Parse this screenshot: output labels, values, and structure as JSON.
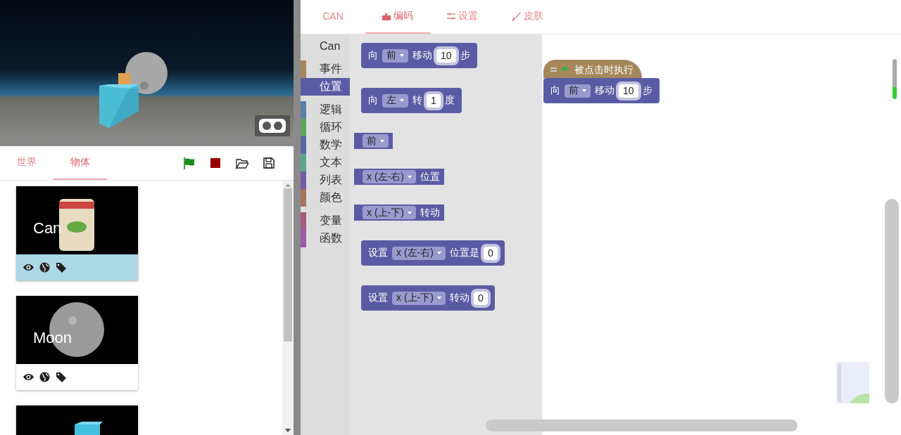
{
  "left_tabs": [
    {
      "label": "世界",
      "selected": false
    },
    {
      "label": "物体",
      "selected": true
    }
  ],
  "objects": [
    {
      "name": "Can",
      "selected": true
    },
    {
      "name": "Moon",
      "selected": false
    }
  ],
  "editor_tabs": [
    {
      "label": "CAN",
      "selected": false
    },
    {
      "label": "编码",
      "selected": true
    },
    {
      "label": "设置",
      "selected": false
    },
    {
      "label": "皮肤",
      "selected": false
    }
  ],
  "toolbox": [
    [
      {
        "label": "Can",
        "selected": false
      }
    ],
    [
      {
        "label": "事件",
        "color": "#a5875a",
        "selected": false
      },
      {
        "label": "位置",
        "color": "#5b5ba5",
        "selected": true
      }
    ],
    [
      {
        "label": "逻辑",
        "color": "#5b80a5",
        "selected": false
      },
      {
        "label": "循环",
        "color": "#5ba55b",
        "selected": false
      },
      {
        "label": "数学",
        "color": "#5b67a5",
        "selected": false
      },
      {
        "label": "文本",
        "color": "#5ba58c",
        "selected": false
      },
      {
        "label": "列表",
        "color": "#745ba5",
        "selected": false
      },
      {
        "label": "颜色",
        "color": "#a5745b",
        "selected": false
      }
    ],
    [
      {
        "label": "变量",
        "color": "#a55b80",
        "selected": false
      },
      {
        "label": "函数",
        "color": "#995ba5",
        "selected": false
      }
    ]
  ],
  "flyout_blocks": [
    {
      "kind": "statement",
      "parts": [
        {
          "kind": "label",
          "text": "向"
        },
        {
          "kind": "dropdown",
          "text": "前"
        },
        {
          "kind": "label",
          "text": "移动"
        },
        {
          "kind": "number",
          "text": "10"
        },
        {
          "kind": "label",
          "text": "步"
        }
      ]
    },
    {
      "kind": "statement",
      "parts": [
        {
          "kind": "label",
          "text": "向"
        },
        {
          "kind": "dropdown",
          "text": "左"
        },
        {
          "kind": "label",
          "text": "转"
        },
        {
          "kind": "number",
          "text": "1"
        },
        {
          "kind": "label",
          "text": "度"
        }
      ]
    },
    {
      "kind": "reporter",
      "parts": [
        {
          "kind": "dropdown",
          "text": "前"
        }
      ]
    },
    {
      "kind": "reporter",
      "parts": [
        {
          "kind": "dropdown",
          "text": "x (左-右)"
        },
        {
          "kind": "label",
          "text": "位置"
        }
      ]
    },
    {
      "kind": "reporter",
      "parts": [
        {
          "kind": "dropdown",
          "text": "x (上-下)"
        },
        {
          "kind": "label",
          "text": "转动"
        }
      ]
    },
    {
      "kind": "statement",
      "parts": [
        {
          "kind": "label",
          "text": "设置"
        },
        {
          "kind": "dropdown",
          "text": "x (左-右)"
        },
        {
          "kind": "label",
          "text": "位置是"
        },
        {
          "kind": "number",
          "text": "0"
        }
      ]
    },
    {
      "kind": "statement",
      "parts": [
        {
          "kind": "label",
          "text": "设置"
        },
        {
          "kind": "dropdown",
          "text": "x (上-下)"
        },
        {
          "kind": "label",
          "text": "转动"
        },
        {
          "kind": "number",
          "text": "0"
        }
      ]
    }
  ],
  "workspace_blocks": [
    {
      "kind": "hat",
      "parts": [
        {
          "kind": "label",
          "text": "被点击时执行"
        }
      ]
    },
    {
      "kind": "statement",
      "parts": [
        {
          "kind": "label",
          "text": "向"
        },
        {
          "kind": "dropdown",
          "text": "前"
        },
        {
          "kind": "label",
          "text": "移动"
        },
        {
          "kind": "number",
          "text": "10"
        },
        {
          "kind": "label",
          "text": "步"
        }
      ]
    }
  ]
}
